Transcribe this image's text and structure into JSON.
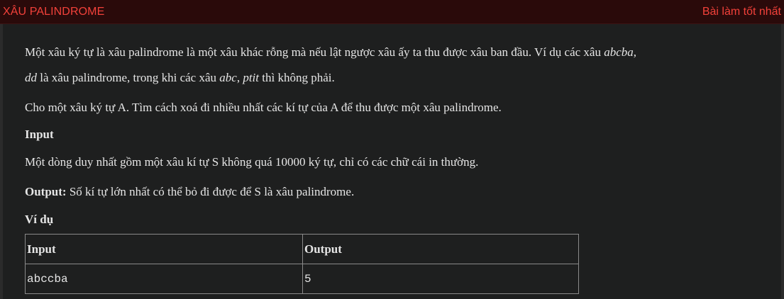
{
  "header": {
    "title": "XÂU PALINDROME",
    "best_link": "Bài làm tốt nhất"
  },
  "statement": {
    "p1_a": "Một xâu ký tự là xâu palindrome là một xâu khác rỗng mà nếu lật ngược xâu ấy ta thu được xâu ban đầu. Ví dụ các xâu ",
    "p1_ex1": "abcba",
    "p1_sep1": ",",
    "p1_ex2": "dd",
    "p1_b": " là xâu palindrome, trong khi các xâu ",
    "p1_ex3": "abc",
    "p1_sep2": ", ",
    "p1_ex4": "ptit",
    "p1_c": " thì không phải.",
    "p2": "Cho một xâu ký tự A. Tìm cách xoá đi nhiều nhất các kí tự của A để thu được một xâu palindrome.",
    "input_heading": "Input",
    "p3": "Một dòng duy nhất gồm một xâu kí tự S không quá 10000 ký tự, chỉ có các chữ cái in thường.",
    "output_label": "Output:",
    "p4": " Số kí tự lớn nhất có thể bỏ đi được để S là xâu palindrome.",
    "example_heading": "Ví dụ"
  },
  "example_table": {
    "headers": [
      "Input",
      "Output"
    ],
    "rows": [
      [
        "abccba",
        "5"
      ]
    ]
  },
  "colors": {
    "accent": "#f2413a",
    "header_bg": "#2a0a0a",
    "content_bg": "#1e1f1f",
    "text": "#e6e6e6"
  }
}
